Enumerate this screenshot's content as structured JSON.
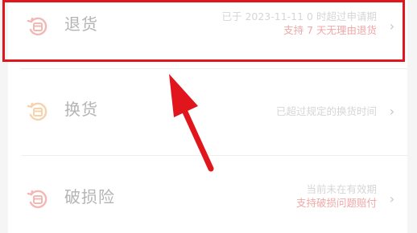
{
  "items": [
    {
      "label": "退货",
      "line1": "已于 2023-11-11 0 时超过申请期",
      "line2": "支持 7 天无理由退货",
      "icon": "return-box-icon"
    },
    {
      "label": "换货",
      "line1": "已超过规定的换货时间",
      "icon": "exchange-box-icon"
    },
    {
      "label": "破损险",
      "line1": "当前未在有效期",
      "line2": "支持破损问题赔付",
      "icon": "damage-insurance-icon"
    }
  ],
  "chevron": "›",
  "colors": {
    "highlight": "#e0161c",
    "arrow": "#e0161c",
    "label": "#b4b4b4",
    "sub_red": "#f0a8a8",
    "sub_gray": "#d6d6d6"
  }
}
